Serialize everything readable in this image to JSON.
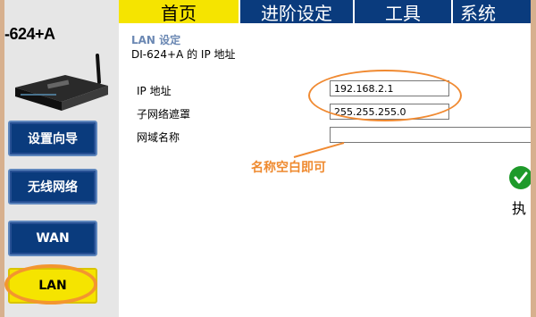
{
  "brand": {
    "model": "-624+A"
  },
  "nav": {
    "tabs": [
      {
        "label": "首页",
        "active": true
      },
      {
        "label": "进阶设定",
        "active": false
      },
      {
        "label": "工具",
        "active": false
      },
      {
        "label": "系统"
      }
    ]
  },
  "sidebar": {
    "items": [
      {
        "label": "设置向导"
      },
      {
        "label": "无线网络"
      },
      {
        "label": "WAN"
      },
      {
        "label": "LAN",
        "active": true
      }
    ]
  },
  "main": {
    "section_title": "LAN 设定",
    "subtitle": "DI-624+A 的 IP 地址",
    "fields": [
      {
        "label": "IP 地址",
        "value": "192.168.2.1"
      },
      {
        "label": "子网络遮罩",
        "value": "255.255.255.0"
      },
      {
        "label": "网域名称",
        "value": ""
      }
    ],
    "note": "名称空白即可",
    "execute_label": "执"
  },
  "colors": {
    "nav_active": "#f5e400",
    "nav_inactive": "#0a3b7d",
    "annotation": "#f08a32"
  },
  "icons": {
    "execute": "check-icon",
    "device": "router-image"
  }
}
